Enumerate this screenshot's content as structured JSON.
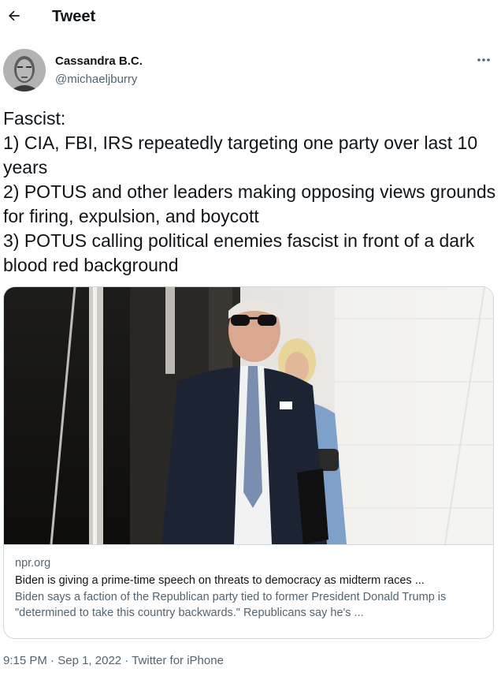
{
  "header": {
    "title": "Tweet",
    "back_icon": "arrow-left-icon"
  },
  "author": {
    "name": "Cassandra B.C.",
    "handle": "@michaeljburry",
    "more_icon": "more-horizontal-icon"
  },
  "tweet": {
    "text": "Fascist:\n1) CIA, FBI, IRS repeatedly targeting one party over last 10 years\n2) POTUS and other leaders making opposing views grounds for firing, expulsion, and boycott\n3) POTUS calling political enemies fascist in front of a dark blood red background"
  },
  "card": {
    "domain": "npr.org",
    "title": "Biden is giving a prime-time speech on threats to democracy as midterm races ...",
    "description": "Biden says a faction of the Republican party tied to former President Donald Trump is \"determined to take this country backwards.\" Republicans say he's ..."
  },
  "meta": {
    "time": "9:15 PM",
    "sep1": " · ",
    "date": "Sep 1, 2022",
    "sep2": " · ",
    "source": "Twitter for iPhone"
  },
  "colors": {
    "text": "#0f1419",
    "secondary": "#536471",
    "border": "#cfd9de"
  }
}
